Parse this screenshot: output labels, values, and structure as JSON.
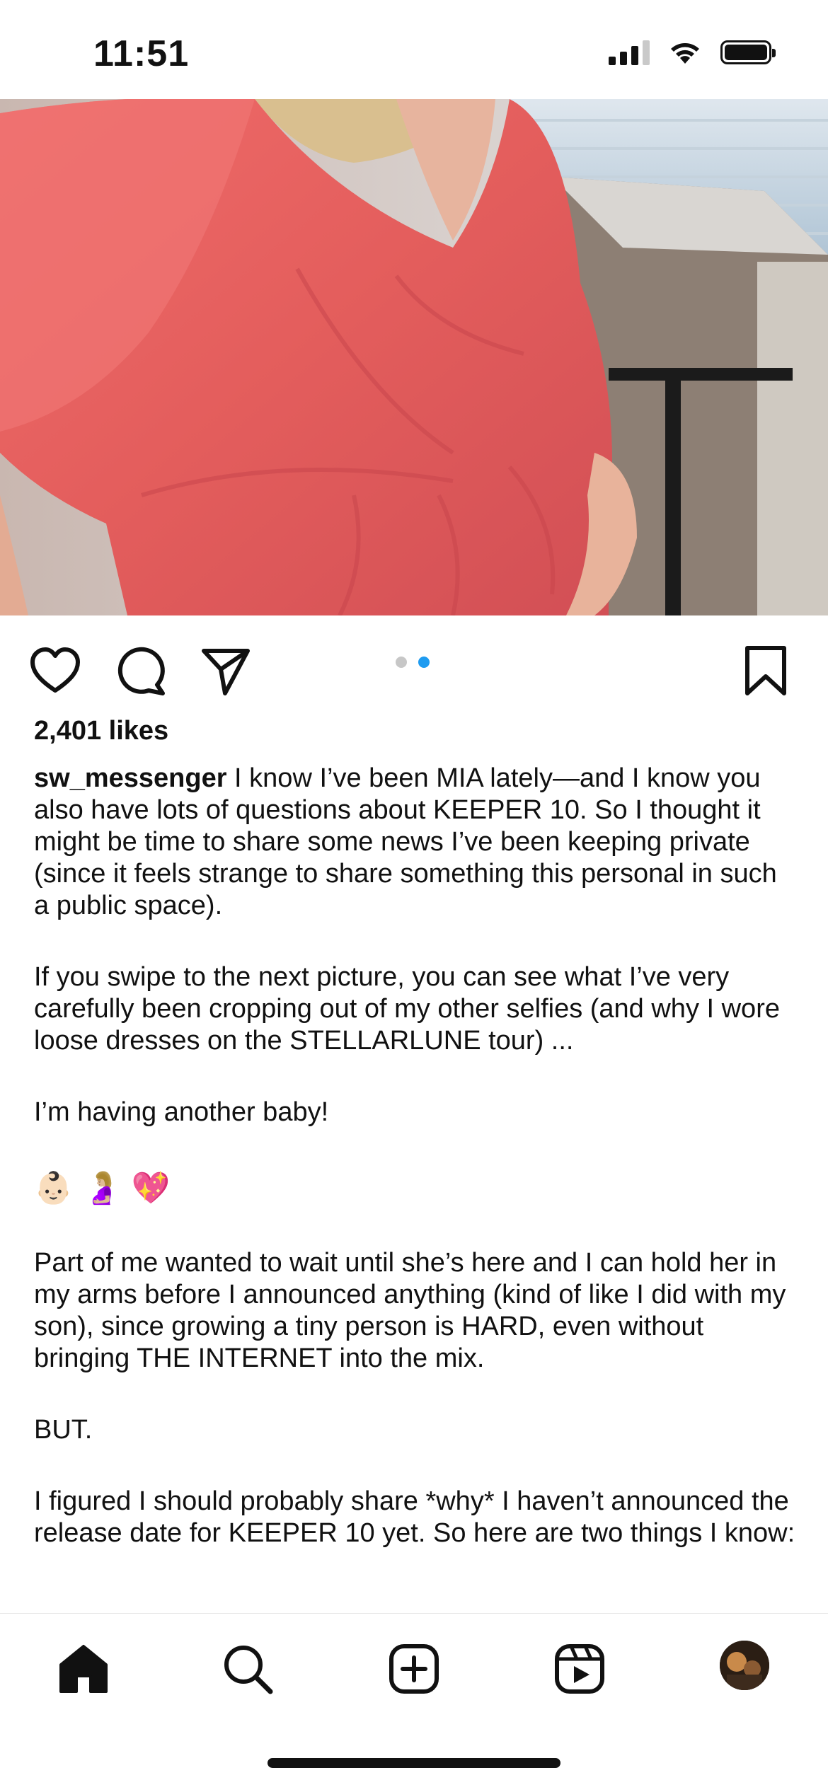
{
  "status_bar": {
    "time": "11:51"
  },
  "post": {
    "carousel": {
      "total": 2,
      "active_index": 2
    },
    "likes": "2,401 likes",
    "username": "sw_messenger",
    "caption_first": " I know I’ve been MIA lately—and I know you also have lots of questions about KEEPER 10. So I thought it might be time to share some news I’ve been keeping private (since it feels strange to share something this personal in such a public space).",
    "paragraphs": [
      "If you swipe to the next picture, you can see what I’ve very carefully been cropping out of my other selfies (and why I wore loose dresses on the STELLARLUNE tour) ...",
      "I’m having another baby!",
      "Part of me wanted to wait until she’s here and I can hold her in my arms before I announced anything (kind of like I did with my son), since growing a tiny person is HARD, even without bringing THE INTERNET into the mix.",
      "BUT.",
      "I figured I should probably share *why* I haven’t announced the release date for KEEPER 10 yet. So here are two things I know:"
    ],
    "emojis": [
      "👶🏻",
      "🤰🏼",
      "💖"
    ]
  },
  "icons": {
    "like": "heart-icon",
    "comment": "comment-icon",
    "share": "send-icon",
    "save": "bookmark-icon"
  },
  "nav": [
    "home-icon",
    "search-icon",
    "create-icon",
    "reels-icon",
    "profile-avatar"
  ],
  "colors": {
    "dot_active": "#1e9bf0",
    "dress": "#e35d5c"
  }
}
